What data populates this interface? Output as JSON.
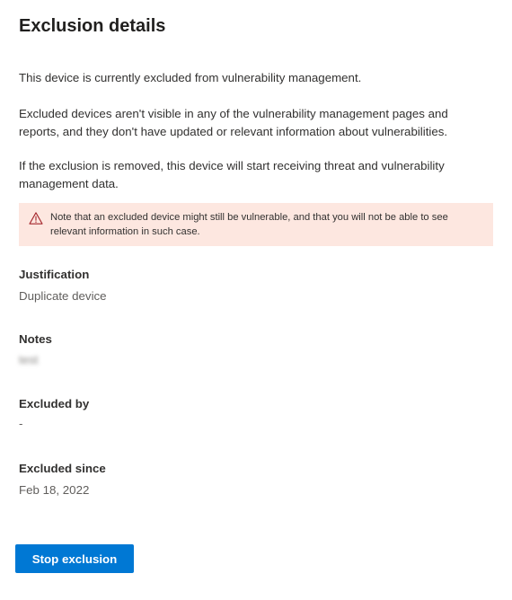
{
  "panel": {
    "title": "Exclusion details",
    "paragraphs": [
      "This device is currently excluded from vulnerability management.",
      "Excluded devices aren't visible in any of the vulnerability management pages and reports, and they don't have updated or relevant information about vulnerabilities.",
      "If the exclusion is removed, this device will start receiving threat and vulnerability management data."
    ],
    "warning": {
      "icon": "warning-triangle-icon",
      "text": "Note that an excluded device might still be vulnerable, and that you will not be able to see relevant information in such case."
    },
    "fields": {
      "justification": {
        "label": "Justification",
        "value": "Duplicate device"
      },
      "notes": {
        "label": "Notes",
        "value": "test"
      },
      "excluded_by": {
        "label": "Excluded by",
        "value": "-"
      },
      "excluded_since": {
        "label": "Excluded since",
        "value": "Feb 18, 2022"
      }
    },
    "actions": {
      "stop_exclusion_label": "Stop exclusion"
    },
    "colors": {
      "accent": "#0078d4",
      "warning_background": "#fde7e0",
      "warning_icon": "#a4262c"
    }
  }
}
